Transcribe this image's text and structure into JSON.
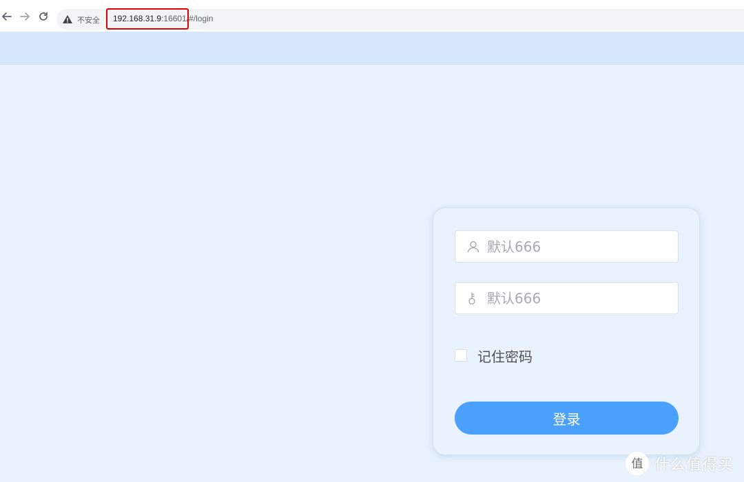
{
  "browser": {
    "security_label": "不安全",
    "url_host": "192.168.31.9",
    "url_port_and_path": ":16601/#/login",
    "icons": {
      "back": "back-arrow-icon",
      "forward": "forward-arrow-icon",
      "reload": "reload-icon",
      "warning": "warning-icon"
    },
    "highlight_color": "#e00000"
  },
  "login": {
    "username_placeholder": "默认666",
    "password_placeholder": "默认666",
    "remember_label": "记住密码",
    "remember_checked": false,
    "submit_label": "登录",
    "icons": {
      "username": "user-icon",
      "password": "key-icon"
    },
    "colors": {
      "primary": "#4aa0fb",
      "background": "#e9f2fd",
      "header": "#d5e8fb"
    }
  },
  "watermark": {
    "logo_char": "值",
    "text": "什么值得买"
  }
}
